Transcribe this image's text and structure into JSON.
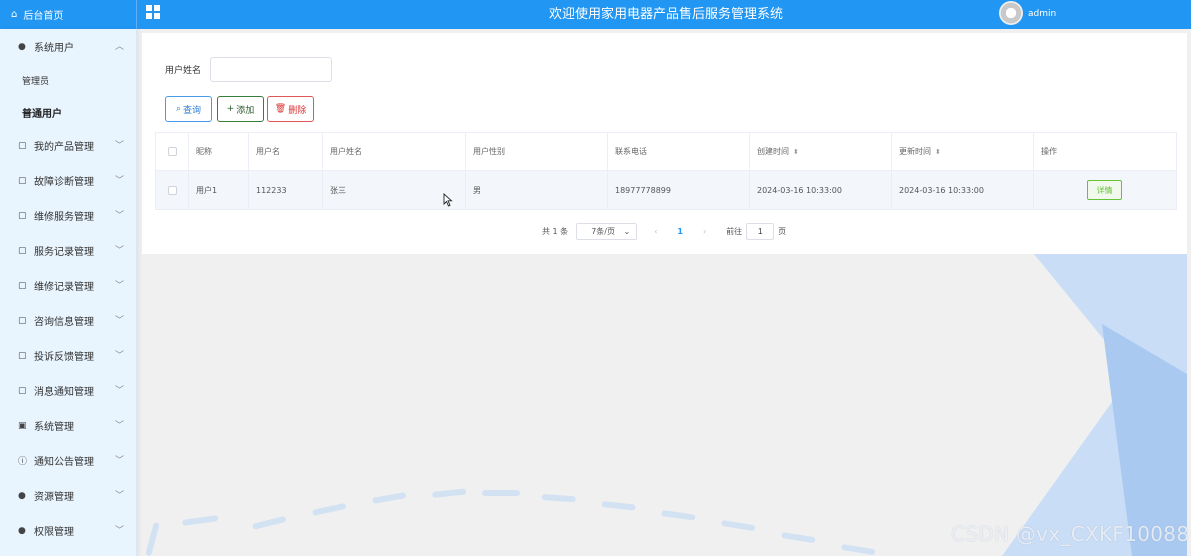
{
  "topbar": {
    "home_label": "后台首页",
    "title": "欢迎使用家用电器产品售后服务管理系统",
    "username": "admin"
  },
  "sidebar": {
    "items": [
      {
        "label": "系统用户",
        "icon": "user-icon",
        "expanded": true
      },
      {
        "label": "我的产品管理",
        "icon": "doc-icon"
      },
      {
        "label": "故障诊断管理",
        "icon": "doc-icon"
      },
      {
        "label": "维修服务管理",
        "icon": "doc-icon"
      },
      {
        "label": "服务记录管理",
        "icon": "doc-icon"
      },
      {
        "label": "维修记录管理",
        "icon": "doc-icon"
      },
      {
        "label": "咨询信息管理",
        "icon": "doc-icon"
      },
      {
        "label": "投诉反馈管理",
        "icon": "doc-icon"
      },
      {
        "label": "消息通知管理",
        "icon": "doc-icon"
      },
      {
        "label": "系统管理",
        "icon": "image-icon"
      },
      {
        "label": "通知公告管理",
        "icon": "info-icon"
      },
      {
        "label": "资源管理",
        "icon": "pin-icon"
      },
      {
        "label": "权限管理",
        "icon": "user-icon"
      }
    ],
    "sub_items": [
      {
        "label": "管理员"
      },
      {
        "label": "普通用户",
        "active": true
      }
    ]
  },
  "search": {
    "label": "用户姓名",
    "value": "",
    "placeholder": ""
  },
  "toolbar": {
    "search_label": "查询",
    "add_label": "添加",
    "delete_label": "删除"
  },
  "table": {
    "headers": [
      "昵称",
      "用户名",
      "用户姓名",
      "用户性别",
      "联系电话",
      "创建时间",
      "更新时间",
      "操作"
    ],
    "rows": [
      [
        "用户1",
        "112233",
        "张三",
        "男",
        "18977778899",
        "2024-03-16 10:33:00",
        "2024-03-16 10:33:00"
      ]
    ],
    "detail_label": "详情"
  },
  "pagination": {
    "total_text": "共 1 条",
    "page_size": "7条/页",
    "current_page": "1",
    "goto_label": "前往",
    "goto_value": "1",
    "page_suffix": "页"
  },
  "watermark": "CSDN @vx_CXKF10088",
  "colors": {
    "primary": "#2196f3",
    "sidebar_bg": "#e8f4fe",
    "success": "#67c23a",
    "danger": "#e05555"
  }
}
